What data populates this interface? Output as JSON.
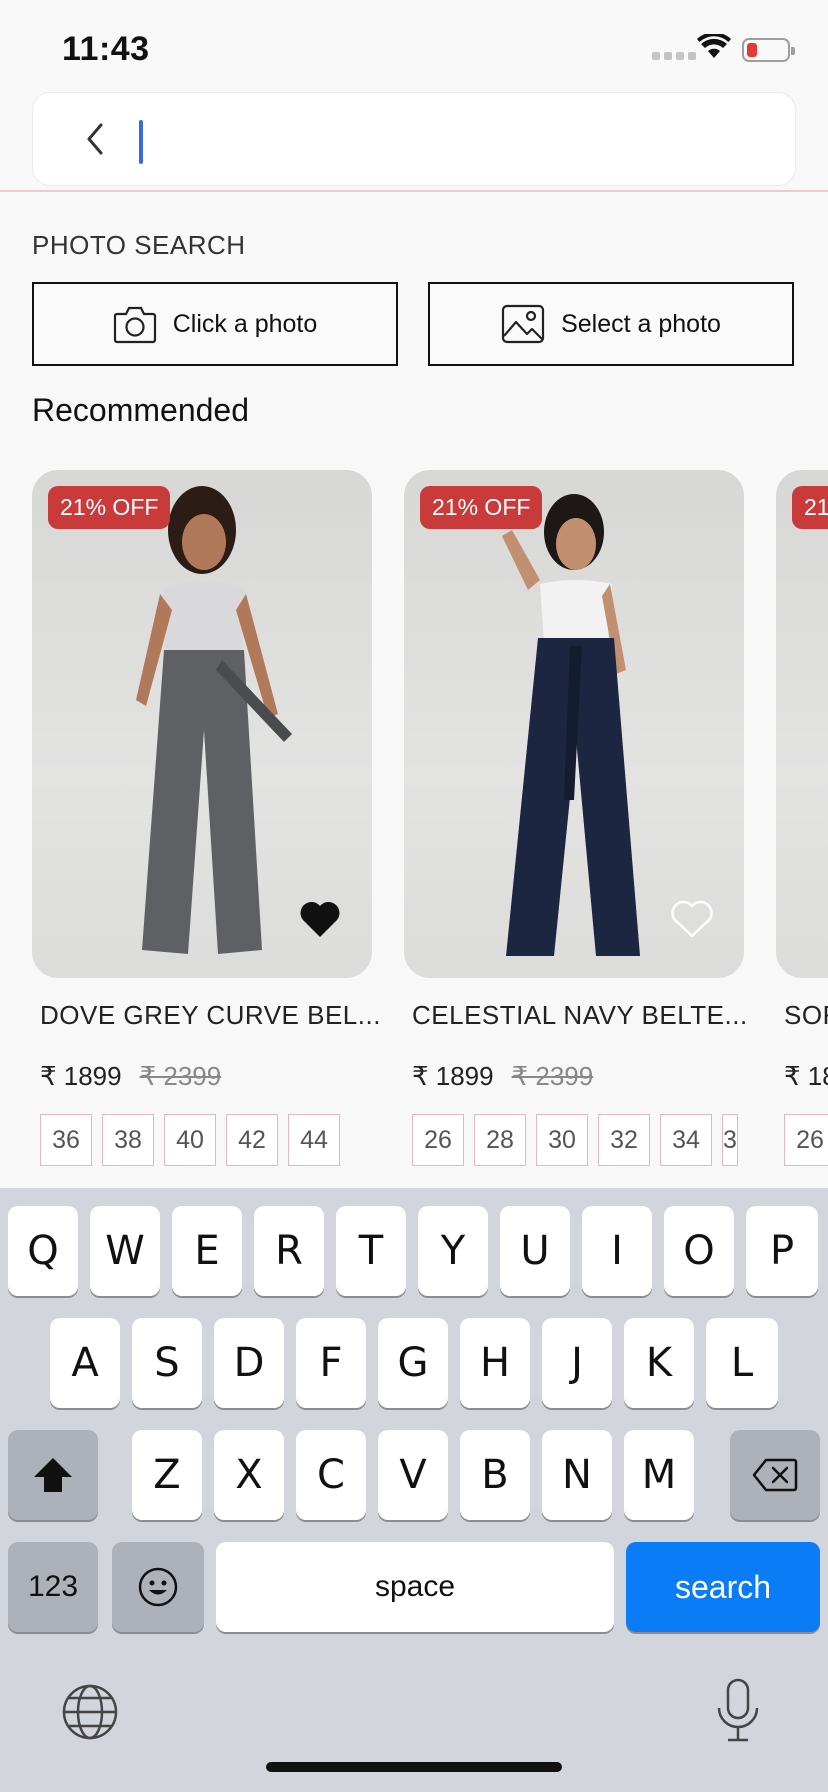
{
  "status_bar": {
    "time": "11:43"
  },
  "search": {
    "placeholder": "",
    "value": ""
  },
  "photo_search": {
    "label": "PHOTO SEARCH",
    "click_label": "Click a photo",
    "select_label": "Select a photo"
  },
  "recommended": {
    "title": "Recommended",
    "products": [
      {
        "badge": "21% OFF",
        "name": "DOVE GREY CURVE BEL...",
        "price": "₹ 1899",
        "mrp": "₹ 2399",
        "sizes": [
          "36",
          "38",
          "40",
          "42",
          "44"
        ],
        "wishlisted": true,
        "pant_color": "#5f6063",
        "top_color": "#d9d9db"
      },
      {
        "badge": "21% OFF",
        "name": "CELESTIAL NAVY BELTE...",
        "price": "₹ 1899",
        "mrp": "₹ 2399",
        "sizes": [
          "26",
          "28",
          "30",
          "32",
          "34",
          "3"
        ],
        "wishlisted": false,
        "pant_color": "#1c2640",
        "top_color": "#f2f2f2"
      },
      {
        "badge": "21",
        "name": "SOF",
        "price": "₹ 18",
        "mrp": "",
        "sizes": [
          "26"
        ],
        "wishlisted": false,
        "pant_color": "#cfcfce",
        "top_color": "#e0e0e0"
      }
    ]
  },
  "keyboard": {
    "row1": [
      "Q",
      "W",
      "E",
      "R",
      "T",
      "Y",
      "U",
      "I",
      "O",
      "P"
    ],
    "row2": [
      "A",
      "S",
      "D",
      "F",
      "G",
      "H",
      "J",
      "K",
      "L"
    ],
    "row3": [
      "Z",
      "X",
      "C",
      "V",
      "B",
      "N",
      "M"
    ],
    "numbers_label": "123",
    "space_label": "space",
    "search_label": "search"
  }
}
